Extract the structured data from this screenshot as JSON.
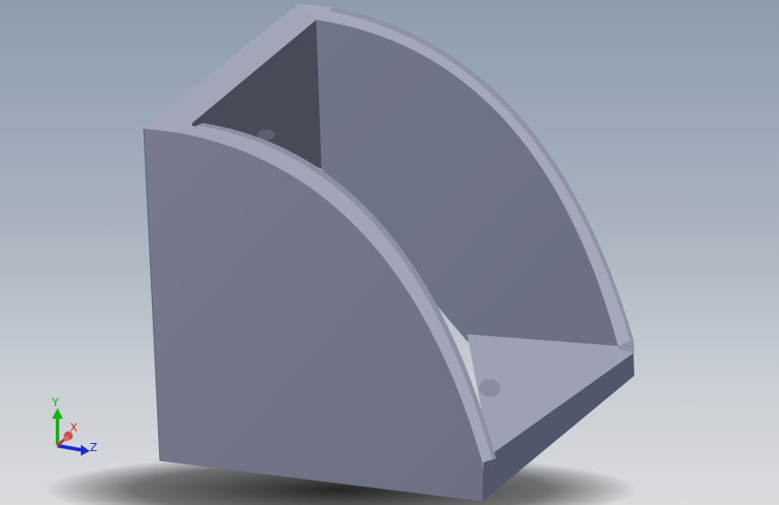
{
  "viewport": {
    "background_top": "#8e9cad",
    "background_bottom": "#d9dcdf",
    "part_color": "#6f7384"
  },
  "triad": {
    "x_label": "X",
    "y_label": "Y",
    "z_label": "Z",
    "x_color": "#e02020",
    "y_color": "#18b018",
    "z_color": "#1c2cc8"
  }
}
